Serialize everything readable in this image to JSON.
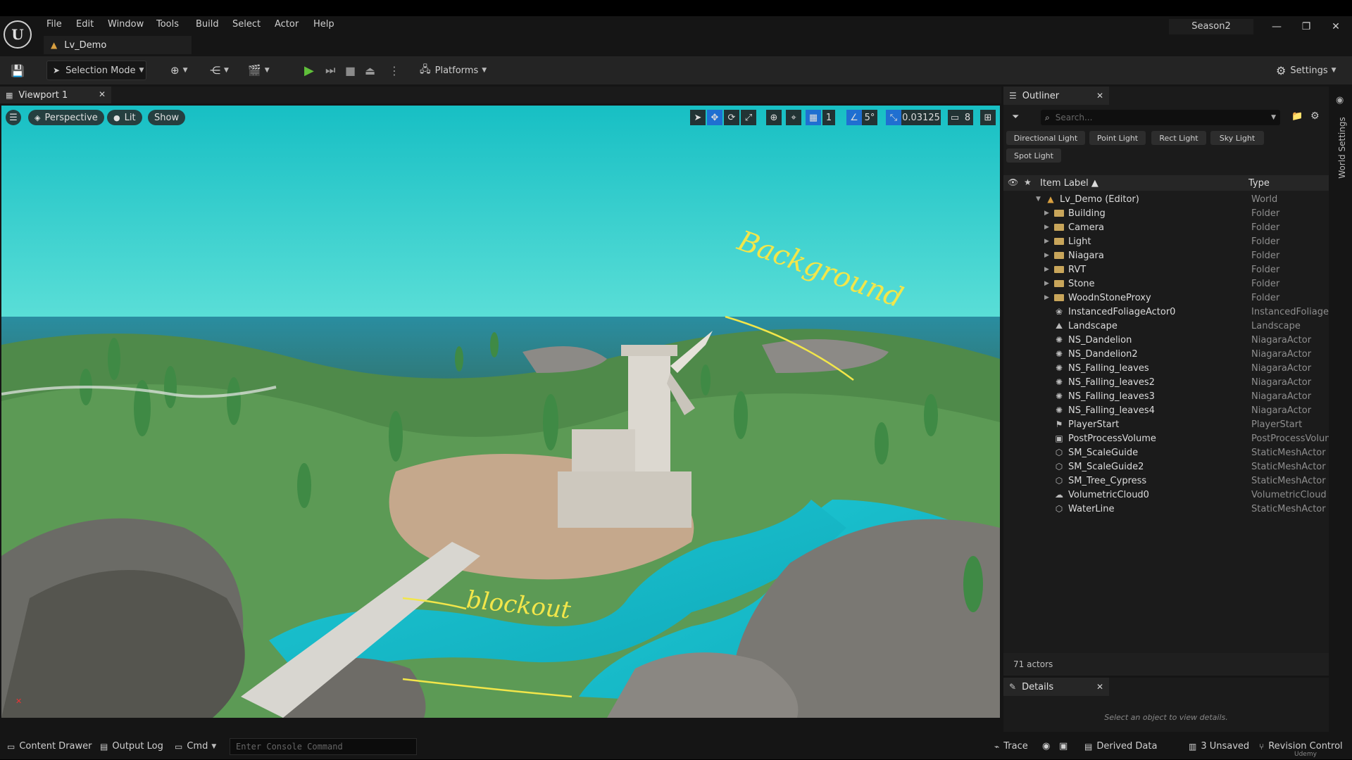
{
  "menubar": {
    "logo": "U",
    "items": [
      "File",
      "Edit",
      "Window",
      "Tools",
      "Build",
      "Select",
      "Actor",
      "Help"
    ],
    "project": "Season2"
  },
  "level_tab": {
    "label": "Lv_Demo"
  },
  "toolbar": {
    "selection_mode": "Selection Mode",
    "platforms": "Platforms",
    "settings": "Settings"
  },
  "viewport": {
    "tab_label": "Viewport 1",
    "perspective": "Perspective",
    "lit": "Lit",
    "show": "Show",
    "grid_size": "1",
    "angle_snap": "5°",
    "scale_snap": "0.03125",
    "camera_speed": "8",
    "annotation_top": "Background",
    "annotation_bottom": "blockout"
  },
  "outliner": {
    "tab_label": "Outliner",
    "search_placeholder": "Search...",
    "filters": [
      "Directional Light",
      "Point Light",
      "Rect Light",
      "Sky Light",
      "Spot Light"
    ],
    "col_label": "Item Label ▲",
    "col_type": "Type",
    "rows": [
      {
        "label": "Lv_Demo (Editor)",
        "type": "World",
        "kind": "world",
        "depth": 0,
        "expand": "open"
      },
      {
        "label": "Building",
        "type": "Folder",
        "kind": "folder",
        "depth": 1,
        "expand": "closed"
      },
      {
        "label": "Camera",
        "type": "Folder",
        "kind": "folder",
        "depth": 1,
        "expand": "closed"
      },
      {
        "label": "Light",
        "type": "Folder",
        "kind": "folder",
        "depth": 1,
        "expand": "closed"
      },
      {
        "label": "Niagara",
        "type": "Folder",
        "kind": "folder",
        "depth": 1,
        "expand": "closed"
      },
      {
        "label": "RVT",
        "type": "Folder",
        "kind": "folder",
        "depth": 1,
        "expand": "closed"
      },
      {
        "label": "Stone",
        "type": "Folder",
        "kind": "folder",
        "depth": 1,
        "expand": "closed"
      },
      {
        "label": "WoodnStoneProxy",
        "type": "Folder",
        "kind": "folder",
        "depth": 1,
        "expand": "closed"
      },
      {
        "label": "InstancedFoliageActor0",
        "type": "InstancedFoliageAc",
        "kind": "foliage",
        "depth": 1,
        "expand": "none"
      },
      {
        "label": "Landscape",
        "type": "Landscape",
        "kind": "landscape",
        "depth": 1,
        "expand": "none"
      },
      {
        "label": "NS_Dandelion",
        "type": "NiagaraActor",
        "kind": "niagara",
        "depth": 1,
        "expand": "none"
      },
      {
        "label": "NS_Dandelion2",
        "type": "NiagaraActor",
        "kind": "niagara",
        "depth": 1,
        "expand": "none"
      },
      {
        "label": "NS_Falling_leaves",
        "type": "NiagaraActor",
        "kind": "niagara",
        "depth": 1,
        "expand": "none"
      },
      {
        "label": "NS_Falling_leaves2",
        "type": "NiagaraActor",
        "kind": "niagara",
        "depth": 1,
        "expand": "none"
      },
      {
        "label": "NS_Falling_leaves3",
        "type": "NiagaraActor",
        "kind": "niagara",
        "depth": 1,
        "expand": "none"
      },
      {
        "label": "NS_Falling_leaves4",
        "type": "NiagaraActor",
        "kind": "niagara",
        "depth": 1,
        "expand": "none"
      },
      {
        "label": "PlayerStart",
        "type": "PlayerStart",
        "kind": "player",
        "depth": 1,
        "expand": "none"
      },
      {
        "label": "PostProcessVolume",
        "type": "PostProcessVolum",
        "kind": "volume",
        "depth": 1,
        "expand": "none"
      },
      {
        "label": "SM_ScaleGuide",
        "type": "StaticMeshActor",
        "kind": "mesh",
        "depth": 1,
        "expand": "none"
      },
      {
        "label": "SM_ScaleGuide2",
        "type": "StaticMeshActor",
        "kind": "mesh",
        "depth": 1,
        "expand": "none"
      },
      {
        "label": "SM_Tree_Cypress",
        "type": "StaticMeshActor",
        "kind": "mesh",
        "depth": 1,
        "expand": "none"
      },
      {
        "label": "VolumetricCloud0",
        "type": "VolumetricCloud",
        "kind": "cloud",
        "depth": 1,
        "expand": "none"
      },
      {
        "label": "WaterLine",
        "type": "StaticMeshActor",
        "kind": "mesh",
        "depth": 1,
        "expand": "none"
      }
    ],
    "actor_count": "71 actors"
  },
  "details": {
    "tab_label": "Details",
    "empty_message": "Select an object to view details."
  },
  "side_panel": {
    "label": "World Settings"
  },
  "statusbar": {
    "content_drawer": "Content Drawer",
    "output_log": "Output Log",
    "cmd": "Cmd",
    "console_placeholder": "Enter Console Command",
    "trace": "Trace",
    "derived_data": "Derived Data",
    "unsaved": "3 Unsaved",
    "revision_control": "Revision Control",
    "watermark": "Udemy"
  },
  "colors": {
    "play_green": "#5fbf3a",
    "accent_blue": "#1f6fd1",
    "annotation_yellow": "#f2e64a"
  }
}
